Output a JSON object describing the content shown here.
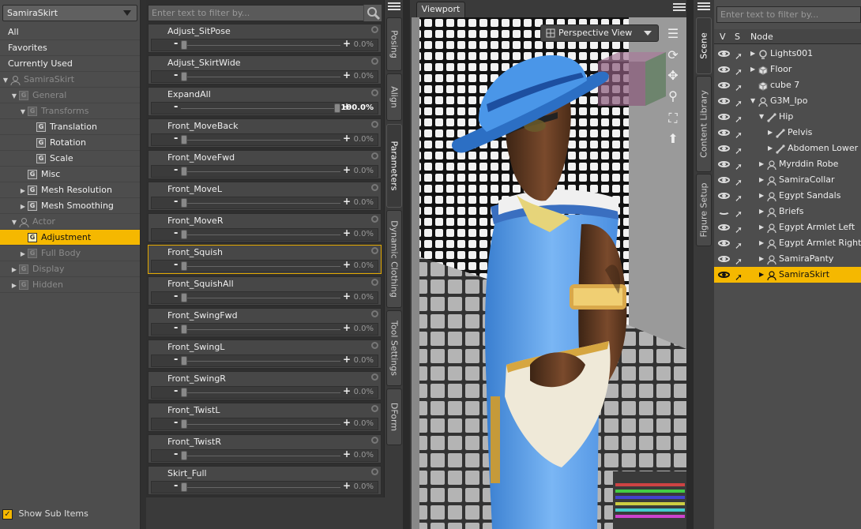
{
  "left_panel": {
    "node_dropdown": "SamiraSkirt",
    "items": [
      {
        "label": "All",
        "indent": 0,
        "type": "plain"
      },
      {
        "label": "Favorites",
        "indent": 0,
        "type": "plain"
      },
      {
        "label": "Currently Used",
        "indent": 0,
        "type": "plain"
      },
      {
        "label": "SamiraSkirt",
        "indent": 0,
        "type": "figure",
        "dim": true,
        "expanded": true
      },
      {
        "label": "General",
        "indent": 1,
        "type": "group",
        "dim": true,
        "expanded": true
      },
      {
        "label": "Transforms",
        "indent": 2,
        "type": "group",
        "dim": true,
        "expanded": true
      },
      {
        "label": "Translation",
        "indent": 3,
        "type": "group"
      },
      {
        "label": "Rotation",
        "indent": 3,
        "type": "group"
      },
      {
        "label": "Scale",
        "indent": 3,
        "type": "group"
      },
      {
        "label": "Misc",
        "indent": 2,
        "type": "group"
      },
      {
        "label": "Mesh Resolution",
        "indent": 2,
        "type": "group",
        "collapsed": true
      },
      {
        "label": "Mesh Smoothing",
        "indent": 2,
        "type": "group",
        "collapsed": true
      },
      {
        "label": "Actor",
        "indent": 1,
        "type": "actor",
        "dim": true,
        "expanded": true
      },
      {
        "label": "Adjustment",
        "indent": 2,
        "type": "group",
        "selected": true
      },
      {
        "label": "Full Body",
        "indent": 2,
        "type": "group",
        "dim": true,
        "collapsed": true
      },
      {
        "label": "Display",
        "indent": 1,
        "type": "group",
        "dim": true,
        "collapsed": true
      },
      {
        "label": "Hidden",
        "indent": 1,
        "type": "group",
        "dim": true,
        "collapsed": true
      }
    ],
    "show_sub_items": "Show Sub Items"
  },
  "parameters_panel": {
    "filter_placeholder": "Enter text to filter by...",
    "params": [
      {
        "name": "Adjust_SitPose",
        "value": "0.0%",
        "fraction": 0
      },
      {
        "name": "Adjust_SkirtWide",
        "value": "0.0%",
        "fraction": 0
      },
      {
        "name": "ExpandAll",
        "value": "100.0%",
        "fraction": 1,
        "full": true
      },
      {
        "name": "Front_MoveBack",
        "value": "0.0%",
        "fraction": 0
      },
      {
        "name": "Front_MoveFwd",
        "value": "0.0%",
        "fraction": 0
      },
      {
        "name": "Front_MoveL",
        "value": "0.0%",
        "fraction": 0
      },
      {
        "name": "Front_MoveR",
        "value": "0.0%",
        "fraction": 0
      },
      {
        "name": "Front_Squish",
        "value": "0.0%",
        "fraction": 0,
        "highlighted": true
      },
      {
        "name": "Front_SquishAll",
        "value": "0.0%",
        "fraction": 0
      },
      {
        "name": "Front_SwingFwd",
        "value": "0.0%",
        "fraction": 0
      },
      {
        "name": "Front_SwingL",
        "value": "0.0%",
        "fraction": 0
      },
      {
        "name": "Front_SwingR",
        "value": "0.0%",
        "fraction": 0
      },
      {
        "name": "Front_TwistL",
        "value": "0.0%",
        "fraction": 0
      },
      {
        "name": "Front_TwistR",
        "value": "0.0%",
        "fraction": 0
      },
      {
        "name": "Skirt_Full",
        "value": "0.0%",
        "fraction": 0
      }
    ]
  },
  "side_tabs_left": [
    "Posing",
    "Align",
    "Parameters",
    "Dynamic Clothing",
    "Tool Settings",
    "DForm"
  ],
  "active_left_tab": "Parameters",
  "viewport": {
    "tab_label": "Viewport",
    "camera": "Perspective View"
  },
  "side_tabs_right": [
    "Scene",
    "Content Library",
    "Figure Setup"
  ],
  "scene_panel": {
    "filter_placeholder": "Enter text to filter by...",
    "columns": {
      "v": "V",
      "s": "S",
      "node": "Node"
    },
    "nodes": [
      {
        "label": "Lights001",
        "indent": 0,
        "icon": "light",
        "visible": true
      },
      {
        "label": "Floor",
        "indent": 0,
        "icon": "cube",
        "visible": true
      },
      {
        "label": "cube 7",
        "indent": 0,
        "icon": "cube",
        "visible": true,
        "no_expander": true
      },
      {
        "label": "G3M_Ipo",
        "indent": 0,
        "icon": "figure",
        "visible": true,
        "expanded": true
      },
      {
        "label": "Hip",
        "indent": 1,
        "icon": "bone",
        "visible": true,
        "expanded": true
      },
      {
        "label": "Pelvis",
        "indent": 2,
        "icon": "bone",
        "visible": true
      },
      {
        "label": "Abdomen Lower",
        "indent": 2,
        "icon": "bone",
        "visible": true
      },
      {
        "label": "Myrddin Robe",
        "indent": 1,
        "icon": "figure",
        "visible": true
      },
      {
        "label": "SamiraCollar",
        "indent": 1,
        "icon": "figure",
        "visible": true
      },
      {
        "label": "Egypt Sandals",
        "indent": 1,
        "icon": "figure",
        "visible": true
      },
      {
        "label": "Briefs",
        "indent": 1,
        "icon": "figure",
        "visible": false
      },
      {
        "label": "Egypt Armlet Left",
        "indent": 1,
        "icon": "figure",
        "visible": true
      },
      {
        "label": "Egypt Armlet Right",
        "indent": 1,
        "icon": "figure",
        "visible": true
      },
      {
        "label": "SamiraPanty",
        "indent": 1,
        "icon": "figure",
        "visible": true
      },
      {
        "label": "SamiraSkirt",
        "indent": 1,
        "icon": "figure",
        "visible": true,
        "selected": true
      }
    ]
  },
  "colors": {
    "accent": "#f5b800",
    "panel": "#4d4d4d",
    "dark": "#2f2f2f"
  }
}
